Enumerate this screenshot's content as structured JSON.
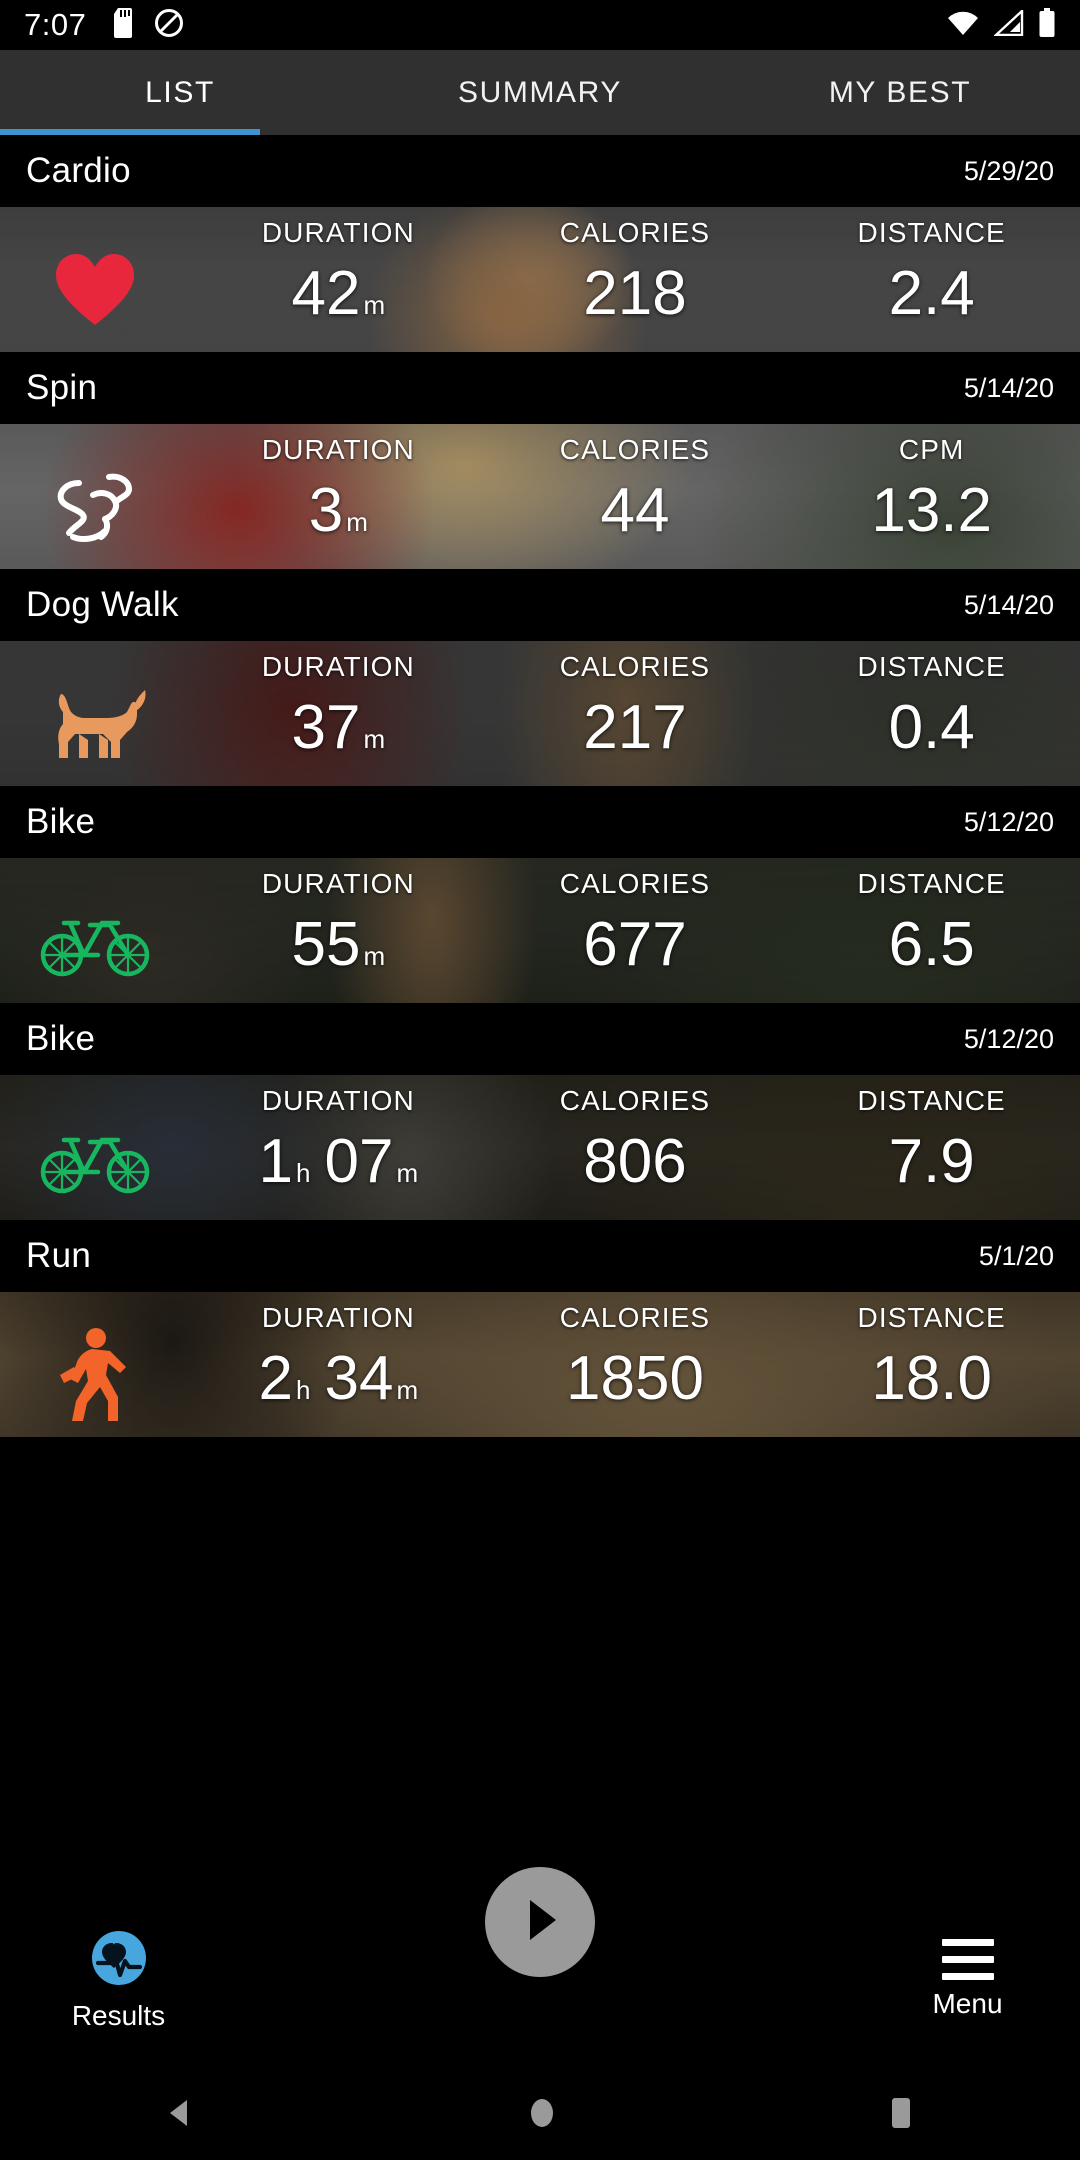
{
  "status_bar": {
    "time": "7:07",
    "icons": [
      "sd-card-icon",
      "do-not-disturb-icon"
    ],
    "right_icons": [
      "wifi-icon",
      "cellular-signal-icon",
      "battery-icon"
    ]
  },
  "tabs": [
    {
      "label": "LIST",
      "active": true
    },
    {
      "label": "SUMMARY",
      "active": false
    },
    {
      "label": "MY BEST",
      "active": false
    }
  ],
  "accent_color": "#3d93d0",
  "workouts": [
    {
      "title": "Cardio",
      "date": "5/29/20",
      "icon": "heart-icon",
      "icon_color": "#e8273c",
      "stats": [
        {
          "label": "DURATION",
          "value": "42",
          "unit": "m"
        },
        {
          "label": "CALORIES",
          "value": "218",
          "unit": ""
        },
        {
          "label": "DISTANCE",
          "value": "2.4",
          "unit": ""
        }
      ]
    },
    {
      "title": "Spin",
      "date": "5/14/20",
      "icon": "spin-cyclist-icon",
      "icon_color": "#ffffff",
      "stats": [
        {
          "label": "DURATION",
          "value": "3",
          "unit": "m"
        },
        {
          "label": "CALORIES",
          "value": "44",
          "unit": ""
        },
        {
          "label": "CPM",
          "value": "13.2",
          "unit": ""
        }
      ]
    },
    {
      "title": "Dog Walk",
      "date": "5/14/20",
      "icon": "dog-icon",
      "icon_color": "#e89a5e",
      "stats": [
        {
          "label": "DURATION",
          "value": "37",
          "unit": "m"
        },
        {
          "label": "CALORIES",
          "value": "217",
          "unit": ""
        },
        {
          "label": "DISTANCE",
          "value": "0.4",
          "unit": ""
        }
      ]
    },
    {
      "title": "Bike",
      "date": "5/12/20",
      "icon": "bicycle-icon",
      "icon_color": "#17b760",
      "stats": [
        {
          "label": "DURATION",
          "value": "55",
          "unit": "m"
        },
        {
          "label": "CALORIES",
          "value": "677",
          "unit": ""
        },
        {
          "label": "DISTANCE",
          "value": "6.5",
          "unit": ""
        }
      ]
    },
    {
      "title": "Bike",
      "date": "5/12/20",
      "icon": "bicycle-icon",
      "icon_color": "#17b760",
      "stats": [
        {
          "label": "DURATION",
          "value": "1",
          "unit": "h",
          "value2": "07",
          "unit2": "m"
        },
        {
          "label": "CALORIES",
          "value": "806",
          "unit": ""
        },
        {
          "label": "DISTANCE",
          "value": "7.9",
          "unit": ""
        }
      ]
    },
    {
      "title": "Run",
      "date": "5/1/20",
      "icon": "runner-icon",
      "icon_color": "#f2642a",
      "stats": [
        {
          "label": "DURATION",
          "value": "2",
          "unit": "h",
          "value2": "34",
          "unit2": "m"
        },
        {
          "label": "CALORIES",
          "value": "1850",
          "unit": ""
        },
        {
          "label": "DISTANCE",
          "value": "18.0",
          "unit": ""
        }
      ]
    }
  ],
  "bottom_bar": {
    "results_label": "Results",
    "results_icon": "heart-pulse-icon",
    "menu_label": "Menu",
    "menu_icon": "hamburger-icon",
    "fab_icon": "play-icon"
  },
  "android_nav": {
    "back": "back-triangle-icon",
    "home": "home-circle-icon",
    "recents": "recents-square-icon"
  }
}
